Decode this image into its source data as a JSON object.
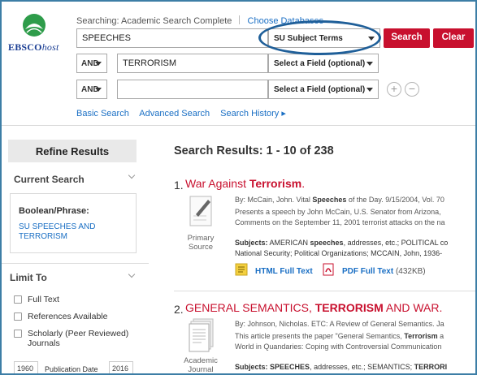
{
  "header": {
    "logo_text_main": "EBSCO",
    "logo_text_host": "host",
    "searching_label": "Searching:",
    "database": "Academic Search Complete",
    "choose_databases": "Choose Databases",
    "rows": [
      {
        "term": "SPEECHES",
        "field": "SU Subject Terms"
      },
      {
        "operator": "AND",
        "term": "TERRORISM",
        "field": "Select a Field (optional)"
      },
      {
        "operator": "AND",
        "term": "",
        "field": "Select a Field (optional)"
      }
    ],
    "search_button": "Search",
    "clear_button": "Clear",
    "add_row": "+",
    "remove_row": "−",
    "links": [
      "Basic Search",
      "Advanced Search",
      "Search History ▸"
    ]
  },
  "sidebar": {
    "refine_title": "Refine Results",
    "current_search_title": "Current Search",
    "boolean_label": "Boolean/Phrase:",
    "query_text": "SU SPEECHES AND TERRORISM",
    "limit_to_title": "Limit To",
    "limits": [
      {
        "label": "Full Text"
      },
      {
        "label": "References Available"
      },
      {
        "label": "Scholarly (Peer Reviewed) Journals"
      }
    ],
    "date_from": "1960",
    "date_label": "Publication Date",
    "date_to": "2016"
  },
  "results": {
    "summary": "Search Results: 1 - 10 of 238",
    "items": [
      {
        "num": "1.",
        "title_pre": "War Against ",
        "title_bold": "Terrorism",
        "title_post": ".",
        "type": "Primary Source",
        "byline_pre": "By: McCain, John. Vital ",
        "byline_bold": "Speeches",
        "byline_post": " of the Day. 9/15/2004, Vol. 70",
        "abstract_1": "Presents a speech by John McCain, U.S. Senator from Arizona,",
        "abstract_2": "Comments on the September 11, 2001 terrorist attacks on the na",
        "subjects_label": "Subjects:",
        "subjects_1_pre": " AMERICAN ",
        "subjects_1_bold": "speeches",
        "subjects_1_post": ", addresses, etc.; POLITICAL co",
        "subjects_2": "National Security; Political Organizations; MCCAIN, John, 1936-",
        "html_full_text": "HTML Full Text",
        "pdf_full_text": "PDF Full Text",
        "pdf_size": "(432KB)"
      },
      {
        "num": "2.",
        "title_a": "GENERAL SEMANTICS, ",
        "title_bold": "TERRORISM",
        "title_b": " AND WAR.",
        "type": "Academic Journal",
        "byline": "By: Johnson, Nicholas. ETC: A Review of General Semantics. Ja",
        "abstract_1_pre": "This article presents the paper \"General Semantics, ",
        "abstract_1_bold": "Terrorism",
        "abstract_1_post": " a",
        "abstract_2": "World in Quandaries: Coping with Controversial Communication",
        "subjects_label": "Subjects:",
        "subjects_pre": " ",
        "subjects_bold_1": "SPEECHES",
        "subjects_mid": ", addresses, etc.; SEMANTICS; ",
        "subjects_bold_2": "TERRORI"
      }
    ]
  },
  "colors": {
    "brand_red": "#c8102e",
    "link_blue": "#1a6fc4",
    "ring_blue": "#1f5f99",
    "logo_navy": "#1c3f94"
  }
}
